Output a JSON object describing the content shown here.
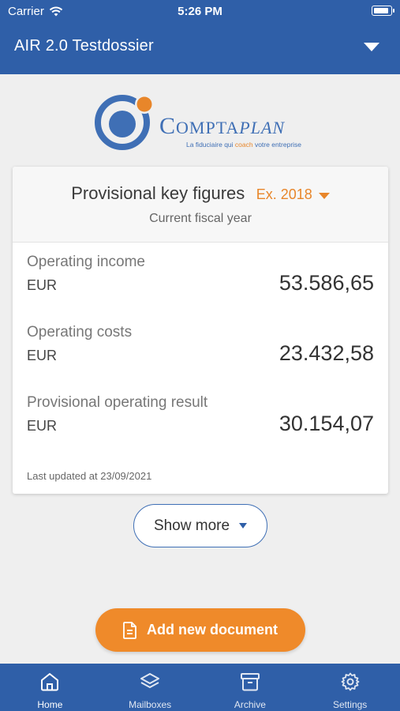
{
  "status_bar": {
    "carrier": "Carrier",
    "time": "5:26 PM"
  },
  "header": {
    "dossier_title": "AIR 2.0 Testdossier",
    "dropdown_icon": "caret-down-icon",
    "background_color": "#2f5fa8"
  },
  "logo": {
    "word_part1": "C",
    "word_part2": "OMPTA",
    "word_part3": "PLAN",
    "tagline_part1": "La fiduciaire qui ",
    "tagline_highlight": "coach",
    "tagline_part2": " votre entreprise",
    "colors": {
      "blue": "#3f6fb5",
      "orange": "#e8862a"
    }
  },
  "key_figures": {
    "title": "Provisional key figures",
    "year_selector": "Ex. 2018",
    "subtitle": "Current fiscal year",
    "items": [
      {
        "label": "Operating income",
        "currency": "EUR",
        "value": "53.586,65"
      },
      {
        "label": "Operating costs",
        "currency": "EUR",
        "value": "23.432,58"
      },
      {
        "label": "Provisional operating result",
        "currency": "EUR",
        "value": "30.154,07"
      }
    ],
    "last_updated": "Last updated at 23/09/2021"
  },
  "show_more": {
    "label": "Show more",
    "icon": "caret-down-icon"
  },
  "add_document": {
    "label": "Add new document",
    "icon": "document-icon",
    "color": "#ef8a2a"
  },
  "tab_bar": {
    "tabs": [
      {
        "label": "Home",
        "icon": "home-icon",
        "active": true
      },
      {
        "label": "Mailboxes",
        "icon": "layers-icon",
        "active": false
      },
      {
        "label": "Archive",
        "icon": "archive-box-icon",
        "active": false
      },
      {
        "label": "Settings",
        "icon": "gear-icon",
        "active": false
      }
    ]
  }
}
